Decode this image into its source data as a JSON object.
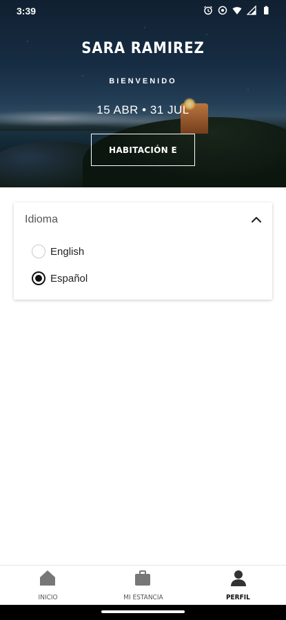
{
  "status_bar": {
    "time": "3:39",
    "icons": [
      "alarm-icon",
      "vpn-icon",
      "wifi-icon",
      "signal-icon",
      "battery-icon"
    ]
  },
  "hero": {
    "guest_name": "SARA RAMIREZ",
    "welcome": "BIENVENIDO",
    "dates": "15 ABR • 31 JUL",
    "room_button": "HABITACIÓN E"
  },
  "language_card": {
    "title": "Idioma",
    "expanded": true,
    "options": [
      {
        "label": "English",
        "selected": false
      },
      {
        "label": "Español",
        "selected": true
      }
    ]
  },
  "bottom_nav": {
    "items": [
      {
        "label": "INICIO",
        "icon": "home-icon",
        "active": false
      },
      {
        "label": "MI ESTANCIA",
        "icon": "suitcase-icon",
        "active": false
      },
      {
        "label": "PERFIL",
        "icon": "person-icon",
        "active": true
      }
    ]
  },
  "colors": {
    "active": "#111111",
    "inactive": "#777777",
    "card_bg": "#ffffff"
  }
}
